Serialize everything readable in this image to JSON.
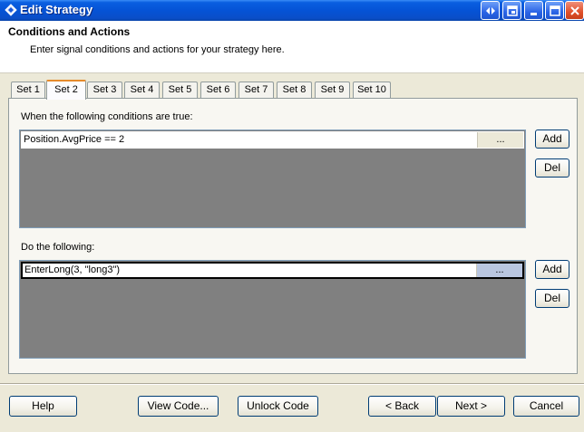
{
  "window": {
    "title": "Edit Strategy",
    "icons": [
      "diamond-app-icon",
      "back-forward-icon",
      "restore-icon",
      "minimize-icon",
      "maximize-icon",
      "close-icon"
    ]
  },
  "header": {
    "title": "Conditions and Actions",
    "subtitle": "Enter signal conditions and actions for your strategy here."
  },
  "tabs": [
    {
      "label": "Set 1"
    },
    {
      "label": "Set 2"
    },
    {
      "label": "Set 3"
    },
    {
      "label": "Set 4"
    },
    {
      "label": "Set 5"
    },
    {
      "label": "Set 6"
    },
    {
      "label": "Set 7"
    },
    {
      "label": "Set 8"
    },
    {
      "label": "Set 9"
    },
    {
      "label": "Set 10"
    }
  ],
  "active_tab": "Set 2",
  "conditions": {
    "label": "When the following conditions are true:",
    "items": [
      {
        "text": "Position.AvgPrice == 2",
        "button": "..."
      }
    ],
    "add_label": "Add",
    "del_label": "Del"
  },
  "actions": {
    "label": "Do the following:",
    "items": [
      {
        "text": "EnterLong(3, \"long3\")",
        "button": "..."
      }
    ],
    "add_label": "Add",
    "del_label": "Del"
  },
  "footer": {
    "help": "Help",
    "view_code": "View Code...",
    "unlock_code": "Unlock Code",
    "back": "< Back",
    "next": "Next >",
    "cancel": "Cancel"
  }
}
